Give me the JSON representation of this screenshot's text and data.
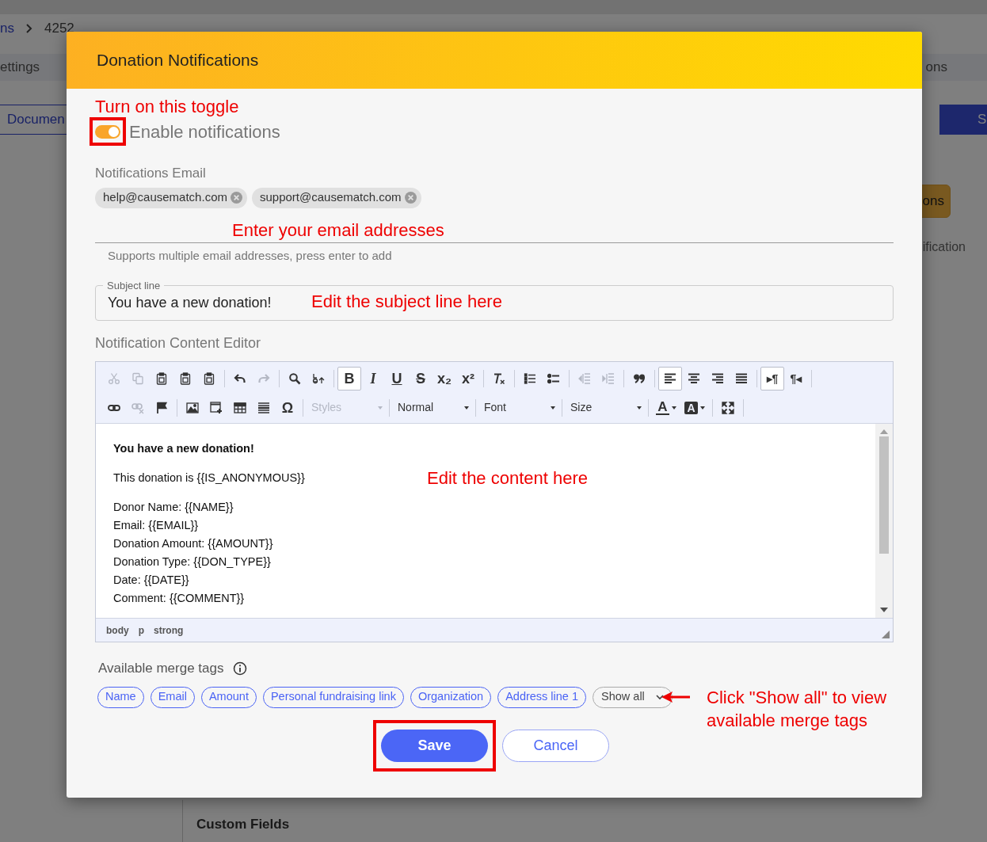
{
  "background": {
    "breadcrumb": [
      {
        "text": "ns",
        "kind": "link"
      },
      {
        "text": "4252",
        "kind": "current"
      }
    ],
    "tab_left": "ettings",
    "tab_right": "ons",
    "left_button": "Documen",
    "right_button": "S",
    "side_button": "ons",
    "side_text": "ification",
    "section_heading": "Custom Fields"
  },
  "modal": {
    "title": "Donation Notifications",
    "toggle": {
      "annotation": "Turn on this toggle",
      "label": "Enable notifications",
      "on": true
    },
    "email": {
      "label": "Notifications Email",
      "chips": [
        "help@causematch.com",
        "support@causematch.com"
      ],
      "annotation": "Enter your email addresses",
      "hint": "Supports multiple email addresses, press enter to add"
    },
    "subject": {
      "label": "Subject line",
      "value": "You have a new donation!",
      "annotation": "Edit the subject line here"
    },
    "editor": {
      "label": "Notification Content Editor",
      "toolbar": [
        [
          [
            {
              "kind": "cut",
              "disabled": true,
              "pressed": false
            },
            {
              "kind": "copy",
              "disabled": true,
              "pressed": false
            },
            {
              "kind": "paste",
              "disabled": false,
              "pressed": false
            },
            {
              "kind": "paste",
              "disabled": false,
              "pressed": false
            },
            {
              "kind": "paste",
              "disabled": false,
              "pressed": false
            }
          ],
          [
            {
              "kind": "undo",
              "disabled": false,
              "pressed": false
            },
            {
              "kind": "redo",
              "disabled": true,
              "pressed": false
            }
          ],
          [
            {
              "kind": "find",
              "disabled": false,
              "pressed": false
            },
            {
              "kind": "replace",
              "disabled": false,
              "pressed": false
            }
          ],
          [
            {
              "kind": "bold",
              "glyph": "B",
              "disabled": false,
              "pressed": true
            },
            {
              "kind": "italic",
              "glyph": "I",
              "disabled": false,
              "pressed": false
            },
            {
              "kind": "underline",
              "glyph": "U",
              "disabled": false,
              "pressed": false
            },
            {
              "kind": "strike",
              "glyph": "S",
              "disabled": false,
              "pressed": false
            },
            {
              "kind": "subscript",
              "glyph": "x₂",
              "disabled": false,
              "pressed": false
            },
            {
              "kind": "superscript",
              "glyph": "x²",
              "disabled": false,
              "pressed": false
            }
          ],
          [
            {
              "kind": "clearformat",
              "disabled": false,
              "pressed": false
            }
          ],
          [
            {
              "kind": "numbered",
              "disabled": false,
              "pressed": false
            },
            {
              "kind": "bulleted",
              "disabled": false,
              "pressed": false
            }
          ],
          [
            {
              "kind": "outdent",
              "disabled": true,
              "pressed": false
            },
            {
              "kind": "indent",
              "disabled": true,
              "pressed": false
            }
          ],
          [
            {
              "kind": "quote",
              "disabled": false,
              "pressed": false
            }
          ],
          [
            {
              "kind": "alignleft",
              "disabled": false,
              "pressed": true
            },
            {
              "kind": "aligncenter",
              "disabled": false,
              "pressed": false
            },
            {
              "kind": "alignright",
              "disabled": false,
              "pressed": false
            },
            {
              "kind": "justify",
              "disabled": false,
              "pressed": false
            }
          ],
          [
            {
              "kind": "ltr",
              "glyph": "▸¶",
              "disabled": false,
              "pressed": true
            },
            {
              "kind": "rtl",
              "glyph": "¶◂",
              "disabled": false,
              "pressed": false
            }
          ]
        ],
        [
          [
            {
              "kind": "link",
              "disabled": false,
              "pressed": false
            },
            {
              "kind": "unlink",
              "disabled": true,
              "pressed": false
            },
            {
              "kind": "flag",
              "disabled": false,
              "pressed": false
            }
          ],
          [
            {
              "kind": "image",
              "disabled": false,
              "pressed": false
            },
            {
              "kind": "frame",
              "disabled": false,
              "pressed": false
            },
            {
              "kind": "table",
              "disabled": false,
              "pressed": false
            },
            {
              "kind": "rule",
              "disabled": false,
              "pressed": false
            },
            {
              "kind": "symbol",
              "glyph": "Ω",
              "disabled": false,
              "pressed": false
            }
          ],
          [
            {
              "kind": "dropdown",
              "label": "Styles",
              "disabled": true,
              "pressed": false
            }
          ],
          [
            {
              "kind": "dropdown",
              "label": "Normal",
              "disabled": false,
              "pressed": false
            }
          ],
          [
            {
              "kind": "dropdown",
              "label": "Font",
              "disabled": false,
              "pressed": false
            }
          ],
          [
            {
              "kind": "dropdown",
              "label": "Size",
              "disabled": false,
              "pressed": false
            }
          ],
          [
            {
              "kind": "textcolor",
              "glyph": "A",
              "disabled": false,
              "pressed": false
            },
            {
              "kind": "bgcolor",
              "glyph": "A",
              "disabled": false,
              "pressed": false
            }
          ],
          [
            {
              "kind": "maximize",
              "disabled": false,
              "pressed": false
            }
          ]
        ]
      ],
      "content": [
        [
          "**You have a new donation!**"
        ],
        [
          "This donation is {{IS_ANONYMOUS}}"
        ],
        [
          "Donor Name: {{NAME}}",
          "Email: {{EMAIL}}",
          "Donation Amount: {{AMOUNT}}",
          "Donation Type: {{DON_TYPE}}",
          "Date: {{DATE}}",
          "Comment: {{COMMENT}}"
        ]
      ],
      "annotation": "Edit the content here",
      "path": [
        "body",
        "p",
        "strong"
      ]
    },
    "merge_tags": {
      "label": "Available merge tags",
      "tags": [
        "Name",
        "Email",
        "Amount",
        "Personal fundraising link",
        "Organization",
        "Address line 1"
      ],
      "show_all": "Show all",
      "annotation": "Click \"Show all\" to view available merge tags"
    },
    "buttons": [
      {
        "label": "Save",
        "kind": "primary",
        "highlighted": true
      },
      {
        "label": "Cancel",
        "kind": "secondary",
        "highlighted": false
      }
    ]
  }
}
